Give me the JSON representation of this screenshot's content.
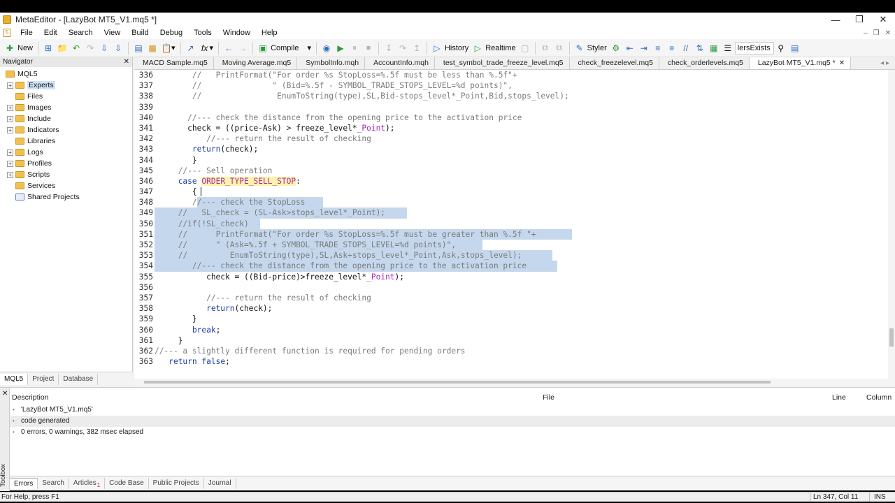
{
  "window": {
    "title": "MetaEditor - [LazyBot MT5_V1.mq5 *]"
  },
  "menu": [
    "File",
    "Edit",
    "Search",
    "View",
    "Build",
    "Debug",
    "Tools",
    "Window",
    "Help"
  ],
  "toolbar": {
    "new_label": "New",
    "compile_label": "Compile",
    "history_label": "History",
    "realtime_label": "Realtime",
    "styler_label": "Styler",
    "search_value": "lersExists"
  },
  "navigator": {
    "title": "Navigator",
    "root": "MQL5",
    "items": [
      {
        "label": "Experts",
        "expandable": true,
        "selected": true
      },
      {
        "label": "Files",
        "expandable": false
      },
      {
        "label": "Images",
        "expandable": true
      },
      {
        "label": "Include",
        "expandable": true
      },
      {
        "label": "Indicators",
        "expandable": true
      },
      {
        "label": "Libraries",
        "expandable": false
      },
      {
        "label": "Logs",
        "expandable": true
      },
      {
        "label": "Profiles",
        "expandable": true
      },
      {
        "label": "Scripts",
        "expandable": true
      },
      {
        "label": "Services",
        "expandable": false
      },
      {
        "label": "Shared Projects",
        "expandable": false,
        "blue": true
      }
    ],
    "tabs": [
      "MQL5",
      "Project",
      "Database"
    ]
  },
  "editor_tabs": [
    {
      "label": "MACD Sample.mq5",
      "active": false
    },
    {
      "label": "Moving Average.mq5",
      "active": false
    },
    {
      "label": "SymbolInfo.mqh",
      "active": false
    },
    {
      "label": "AccountInfo.mqh",
      "active": false
    },
    {
      "label": "test_symbol_trade_freeze_level.mq5",
      "active": false
    },
    {
      "label": "check_freezelevel.mq5",
      "active": false
    },
    {
      "label": "check_orderlevels.mq5",
      "active": false
    },
    {
      "label": "LazyBot MT5_V1.mq5 *",
      "active": true
    }
  ],
  "code_lines": [
    {
      "n": "336",
      "segs": [
        [
          "        ",
          ""
        ],
        [
          "//   PrintFormat(\"For order %s StopLoss=%.5f must be less than %.5f\"+",
          "cm"
        ]
      ]
    },
    {
      "n": "337",
      "segs": [
        [
          "        ",
          ""
        ],
        [
          "//               \" (Bid=%.5f - SYMBOL_TRADE_STOPS_LEVEL=%d points)\",",
          "cm"
        ]
      ]
    },
    {
      "n": "338",
      "segs": [
        [
          "        ",
          ""
        ],
        [
          "//                EnumToString(type),SL,Bid-stops_level*_Point,Bid,stops_level);",
          "cm"
        ]
      ]
    },
    {
      "n": "339",
      "segs": []
    },
    {
      "n": "340",
      "segs": [
        [
          "       ",
          ""
        ],
        [
          "//--- check the distance from the opening price to the activation price",
          "cm"
        ]
      ]
    },
    {
      "n": "341",
      "segs": [
        [
          "       check = ((price-Ask) > freeze_level*",
          "nm"
        ],
        [
          "_Point",
          "cn"
        ],
        [
          ");",
          "nm"
        ]
      ]
    },
    {
      "n": "342",
      "segs": [
        [
          "           ",
          ""
        ],
        [
          "//--- return the result of checking",
          "cm"
        ]
      ]
    },
    {
      "n": "343",
      "segs": [
        [
          "        ",
          ""
        ],
        [
          "return",
          "kw"
        ],
        [
          "(check);",
          "nm"
        ]
      ]
    },
    {
      "n": "344",
      "segs": [
        [
          "        }",
          "nm"
        ]
      ]
    },
    {
      "n": "345",
      "segs": [
        [
          "     ",
          ""
        ],
        [
          "//--- Sell operation",
          "cm"
        ]
      ]
    },
    {
      "n": "346",
      "segs": [
        [
          "     ",
          ""
        ],
        [
          "case",
          "kw"
        ],
        [
          " ",
          ""
        ],
        [
          "ORDER_TYPE_SELL_STOP",
          "cn hl"
        ],
        [
          ":",
          "nm"
        ]
      ]
    },
    {
      "n": "347",
      "segs": [
        [
          "        {",
          "nm"
        ]
      ]
    },
    {
      "n": "348",
      "segs": [
        [
          "        ",
          ""
        ],
        [
          "//--- check the StopLoss",
          "cm"
        ]
      ],
      "sel": [
        90,
        270
      ]
    },
    {
      "n": "349",
      "segs": [
        [
          "     ",
          ""
        ],
        [
          "//   SL_check = (SL-Ask>stops_level*_Point);",
          "cm"
        ]
      ],
      "sel": [
        29,
        390
      ]
    },
    {
      "n": "350",
      "segs": [
        [
          "     ",
          ""
        ],
        [
          "//if(!SL_check)",
          "cm"
        ]
      ],
      "sel": [
        29,
        180
      ]
    },
    {
      "n": "351",
      "segs": [
        [
          "     ",
          ""
        ],
        [
          "//      PrintFormat(\"For order %s StopLoss=%.5f must be greater than %.5f \"+",
          "cm"
        ]
      ],
      "sel": [
        29,
        626
      ]
    },
    {
      "n": "352",
      "segs": [
        [
          "     ",
          ""
        ],
        [
          "//      \" (Ask=%.5f + SYMBOL_TRADE_STOPS_LEVEL=%d points)\",",
          "cm"
        ]
      ],
      "sel": [
        29,
        498
      ]
    },
    {
      "n": "353",
      "segs": [
        [
          "     ",
          ""
        ],
        [
          "//         EnumToString(type),SL,Ask+stops_level*_Point,Ask,stops_level);",
          "cm"
        ]
      ],
      "sel": [
        29,
        598
      ]
    },
    {
      "n": "354",
      "segs": [
        [
          "        ",
          ""
        ],
        [
          "//--- check the distance from the opening price to the activation price",
          "cm"
        ]
      ],
      "sel": [
        29,
        605
      ]
    },
    {
      "n": "355",
      "segs": [
        [
          "           check = ((Bid-price)>freeze_level*",
          "nm"
        ],
        [
          "_Point",
          "cn"
        ],
        [
          ");",
          "nm"
        ]
      ]
    },
    {
      "n": "356",
      "segs": []
    },
    {
      "n": "357",
      "segs": [
        [
          "           ",
          ""
        ],
        [
          "//--- return the result of checking",
          "cm"
        ]
      ]
    },
    {
      "n": "358",
      "segs": [
        [
          "           ",
          ""
        ],
        [
          "return",
          "kw"
        ],
        [
          "(check);",
          "nm"
        ]
      ]
    },
    {
      "n": "359",
      "segs": [
        [
          "        }",
          "nm"
        ]
      ]
    },
    {
      "n": "360",
      "segs": [
        [
          "        ",
          ""
        ],
        [
          "break",
          "kw"
        ],
        [
          ";",
          "nm"
        ]
      ]
    },
    {
      "n": "361",
      "segs": [
        [
          "     }",
          "nm"
        ]
      ]
    },
    {
      "n": "362",
      "segs": [
        [
          "",
          ""
        ],
        [
          "//--- a slightly different function is required for pending orders",
          "cm"
        ]
      ]
    },
    {
      "n": "363",
      "segs": [
        [
          "   ",
          ""
        ],
        [
          "return",
          "kw"
        ],
        [
          " ",
          ""
        ],
        [
          "false",
          "kw"
        ],
        [
          ";",
          "nm"
        ]
      ]
    }
  ],
  "toolbox": {
    "label": "Toolbox",
    "headers": {
      "description": "Description",
      "file": "File",
      "line": "Line",
      "column": "Column"
    },
    "messages": [
      {
        "text": "'LazyBot MT5_V1.mq5'",
        "alt": false
      },
      {
        "text": "code generated",
        "alt": true
      },
      {
        "text": "0 errors, 0 warnings, 382 msec elapsed",
        "alt": false
      }
    ],
    "tabs": [
      {
        "label": "Errors",
        "active": true
      },
      {
        "label": "Search",
        "active": false
      },
      {
        "label": "Articles",
        "active": false,
        "badge": "1"
      },
      {
        "label": "Code Base",
        "active": false
      },
      {
        "label": "Public Projects",
        "active": false
      },
      {
        "label": "Journal",
        "active": false
      }
    ]
  },
  "status": {
    "help": "For Help, press F1",
    "position": "Ln 347, Col 11",
    "mode": "INS"
  }
}
